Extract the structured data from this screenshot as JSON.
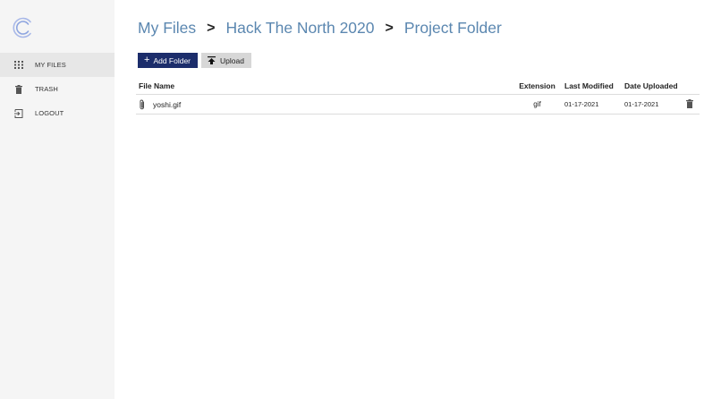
{
  "sidebar": {
    "items": [
      {
        "label": "MY FILES",
        "icon": "grid-icon",
        "active": true
      },
      {
        "label": "TRASH",
        "icon": "trash-icon",
        "active": false
      },
      {
        "label": "LOGOUT",
        "icon": "logout-icon",
        "active": false
      }
    ]
  },
  "breadcrumb": {
    "items": [
      "My Files",
      "Hack The North 2020",
      "Project Folder"
    ],
    "separator": ">"
  },
  "toolbar": {
    "add_folder_label": "Add Folder",
    "upload_label": "Upload"
  },
  "table": {
    "headers": {
      "name": "File Name",
      "extension": "Extension",
      "modified": "Last Modified",
      "uploaded": "Date Uploaded"
    },
    "rows": [
      {
        "name": "yoshi.gif",
        "extension": "gif",
        "modified": "01-17-2021",
        "uploaded": "01-17-2021"
      }
    ]
  },
  "colors": {
    "accent": "#1c2d6b",
    "breadcrumb": "#5b87b0",
    "sidebar_bg": "#f5f5f5",
    "sidebar_active": "#e7e7e7"
  }
}
